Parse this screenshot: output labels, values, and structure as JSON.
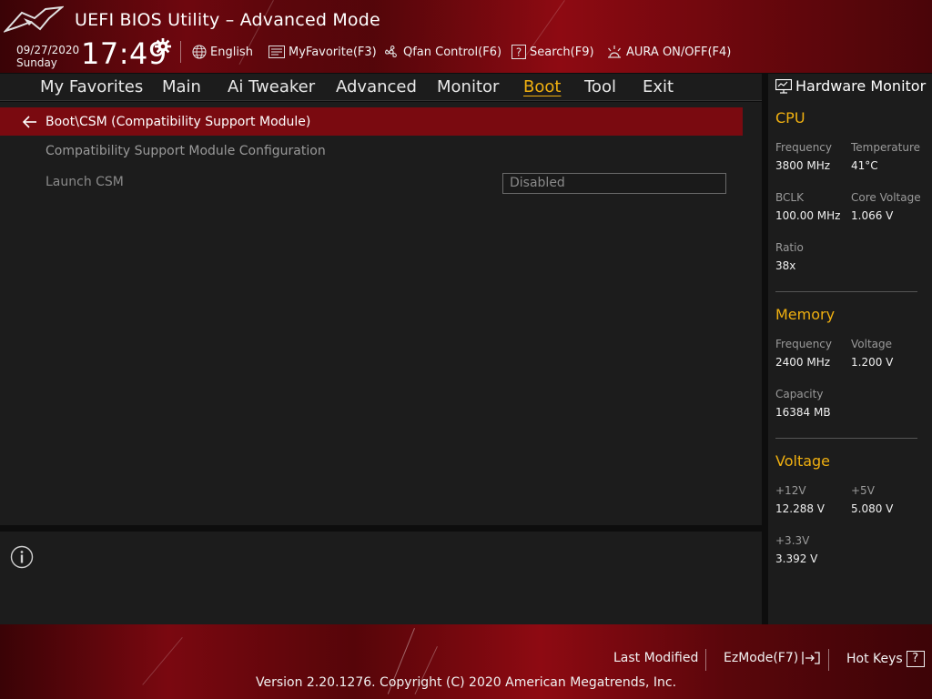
{
  "header": {
    "title": "UEFI BIOS Utility – Advanced Mode",
    "date": "09/27/2020",
    "day": "Sunday",
    "time": "17:49",
    "toolbar": {
      "language": "English",
      "myfavorite": "MyFavorite(F3)",
      "qfan": "Qfan Control(F6)",
      "search": "Search(F9)",
      "aura": "AURA ON/OFF(F4)"
    }
  },
  "menu": {
    "items": [
      "My Favorites",
      "Main",
      "Ai Tweaker",
      "Advanced",
      "Monitor",
      "Boot",
      "Tool",
      "Exit"
    ],
    "active": "Boot"
  },
  "main": {
    "breadcrumb": "Boot\\CSM (Compatibility Support Module)",
    "section_title": "Compatibility Support Module Configuration",
    "options": [
      {
        "label": "Launch CSM",
        "value": "Disabled"
      }
    ]
  },
  "hwmon": {
    "title": "Hardware Monitor",
    "cpu": {
      "heading": "CPU",
      "frequency_label": "Frequency",
      "frequency": "3800 MHz",
      "temperature_label": "Temperature",
      "temperature": "41°C",
      "bclk_label": "BCLK",
      "bclk": "100.00 MHz",
      "core_voltage_label": "Core Voltage",
      "core_voltage": "1.066 V",
      "ratio_label": "Ratio",
      "ratio": "38x"
    },
    "memory": {
      "heading": "Memory",
      "frequency_label": "Frequency",
      "frequency": "2400 MHz",
      "voltage_label": "Voltage",
      "voltage": "1.200 V",
      "capacity_label": "Capacity",
      "capacity": "16384 MB"
    },
    "voltage": {
      "heading": "Voltage",
      "v12_label": "+12V",
      "v12": "12.288 V",
      "v5_label": "+5V",
      "v5": "5.080 V",
      "v33_label": "+3.3V",
      "v33": "3.392 V"
    }
  },
  "footer": {
    "last_modified": "Last Modified",
    "ezmode": "EzMode(F7)",
    "hotkeys": "Hot Keys",
    "hotkeys_glyph": "?",
    "version": "Version 2.20.1276. Copyright (C) 2020 American Megatrends, Inc."
  },
  "colors": {
    "accent": "#f0b010",
    "breadcrumb_bg": "#7a0a10",
    "panel_bg": "#1c1c1c",
    "brand_red": "#8e0a12"
  }
}
